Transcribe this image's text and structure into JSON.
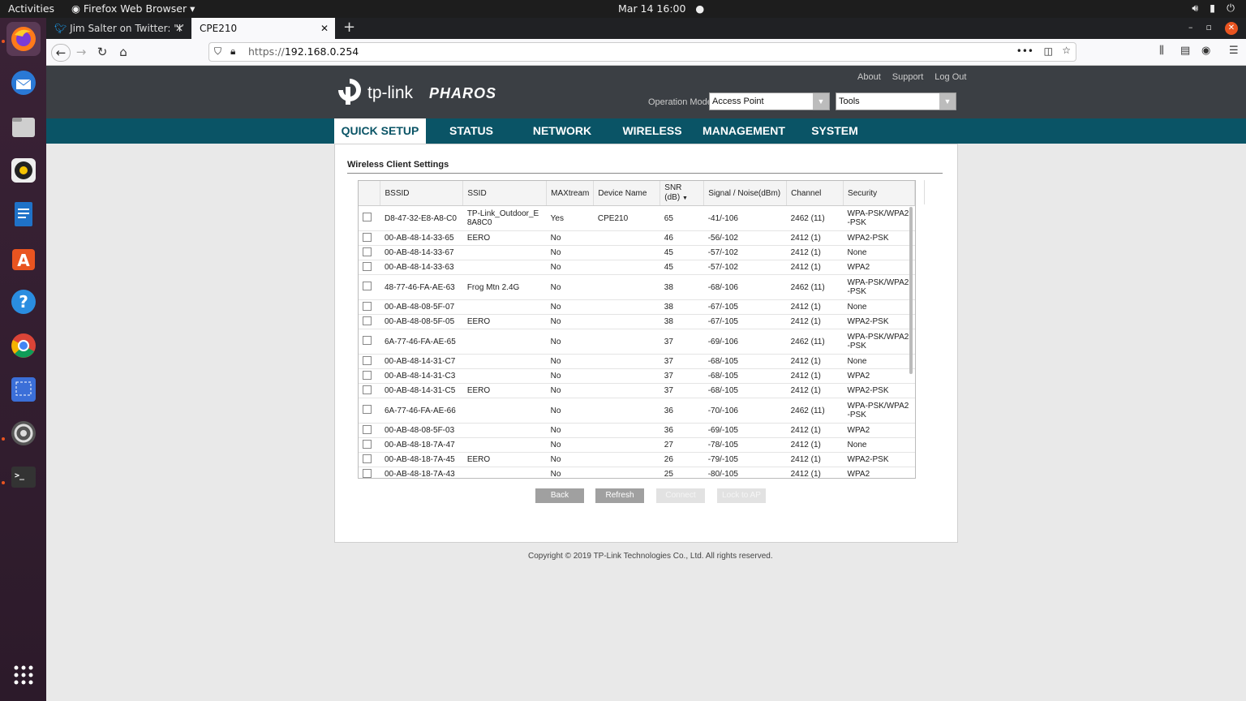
{
  "topbar": {
    "activities": "Activities",
    "app_menu": "Firefox Web Browser ▾",
    "clock": "Mar 14  16:00",
    "indicator": "●"
  },
  "dock": {
    "items": [
      "firefox-icon",
      "thunderbird-icon",
      "files-icon",
      "rhythmbox-icon",
      "writer-icon",
      "software-icon",
      "help-icon",
      "chrome-icon",
      "screenshot-icon",
      "settings-icon",
      "terminal-icon"
    ],
    "apps_grid": "show-apps-icon"
  },
  "browser": {
    "tabs": [
      {
        "label": "Jim Salter on Twitter: \"I’",
        "close": "✕"
      },
      {
        "label": "CPE210",
        "close": "✕"
      }
    ],
    "new_tab": "+",
    "url_scheme": "https://",
    "url_host": "192.168.0.254",
    "page_actions": "•••",
    "win_min": "–",
    "win_max": "▫",
    "win_close": "✕"
  },
  "header": {
    "logo_text": "tp-link",
    "brand": "PHAROS",
    "links": [
      "About",
      "Support",
      "Log Out"
    ],
    "opmode_label": "Operation Mode:",
    "opmode_value": "Access Point",
    "tools_value": "Tools"
  },
  "menu": [
    "QUICK SETUP",
    "STATUS",
    "NETWORK",
    "WIRELESS",
    "MANAGEMENT",
    "SYSTEM"
  ],
  "panel": {
    "title": "Wireless Client Settings"
  },
  "table": {
    "headers": [
      "BSSID",
      "SSID",
      "MAXtream",
      "Device Name",
      "SNR\n(dB)",
      "Signal / Noise(dBm)",
      "Channel",
      "Security"
    ],
    "rows": [
      [
        "D8-47-32-E8-A8-C0",
        "TP-Link_Outdoor_E8A8C0",
        "Yes",
        "CPE210",
        "65",
        "-41/-106",
        "2462 (11)",
        "WPA-PSK/WPA2-PSK"
      ],
      [
        "00-AB-48-14-33-65",
        "EERO",
        "No",
        "",
        "46",
        "-56/-102",
        "2412 (1)",
        "WPA2-PSK"
      ],
      [
        "00-AB-48-14-33-67",
        "",
        "No",
        "",
        "45",
        "-57/-102",
        "2412 (1)",
        "None"
      ],
      [
        "00-AB-48-14-33-63",
        "",
        "No",
        "",
        "45",
        "-57/-102",
        "2412 (1)",
        "WPA2"
      ],
      [
        "48-77-46-FA-AE-63",
        "Frog Mtn 2.4G",
        "No",
        "",
        "38",
        "-68/-106",
        "2462 (11)",
        "WPA-PSK/WPA2-PSK"
      ],
      [
        "00-AB-48-08-5F-07",
        "",
        "No",
        "",
        "38",
        "-67/-105",
        "2412 (1)",
        "None"
      ],
      [
        "00-AB-48-08-5F-05",
        "EERO",
        "No",
        "",
        "38",
        "-67/-105",
        "2412 (1)",
        "WPA2-PSK"
      ],
      [
        "6A-77-46-FA-AE-65",
        "",
        "No",
        "",
        "37",
        "-69/-106",
        "2462 (11)",
        "WPA-PSK/WPA2-PSK"
      ],
      [
        "00-AB-48-14-31-C7",
        "",
        "No",
        "",
        "37",
        "-68/-105",
        "2412 (1)",
        "None"
      ],
      [
        "00-AB-48-14-31-C3",
        "",
        "No",
        "",
        "37",
        "-68/-105",
        "2412 (1)",
        "WPA2"
      ],
      [
        "00-AB-48-14-31-C5",
        "EERO",
        "No",
        "",
        "37",
        "-68/-105",
        "2412 (1)",
        "WPA2-PSK"
      ],
      [
        "6A-77-46-FA-AE-66",
        "",
        "No",
        "",
        "36",
        "-70/-106",
        "2462 (11)",
        "WPA-PSK/WPA2-PSK"
      ],
      [
        "00-AB-48-08-5F-03",
        "",
        "No",
        "",
        "36",
        "-69/-105",
        "2412 (1)",
        "WPA2"
      ],
      [
        "00-AB-48-18-7A-47",
        "",
        "No",
        "",
        "27",
        "-78/-105",
        "2412 (1)",
        "None"
      ],
      [
        "00-AB-48-18-7A-45",
        "EERO",
        "No",
        "",
        "26",
        "-79/-105",
        "2412 (1)",
        "WPA2-PSK"
      ],
      [
        "00-AB-48-18-7A-43",
        "",
        "No",
        "",
        "25",
        "-80/-105",
        "2412 (1)",
        "WPA2"
      ]
    ]
  },
  "buttons": {
    "back": "Back",
    "refresh": "Refresh",
    "connect": "Connect",
    "lock": "Lock to AP"
  },
  "footer": {
    "copyright": "Copyright © 2019 TP-Link Technologies Co., Ltd. All rights reserved."
  }
}
